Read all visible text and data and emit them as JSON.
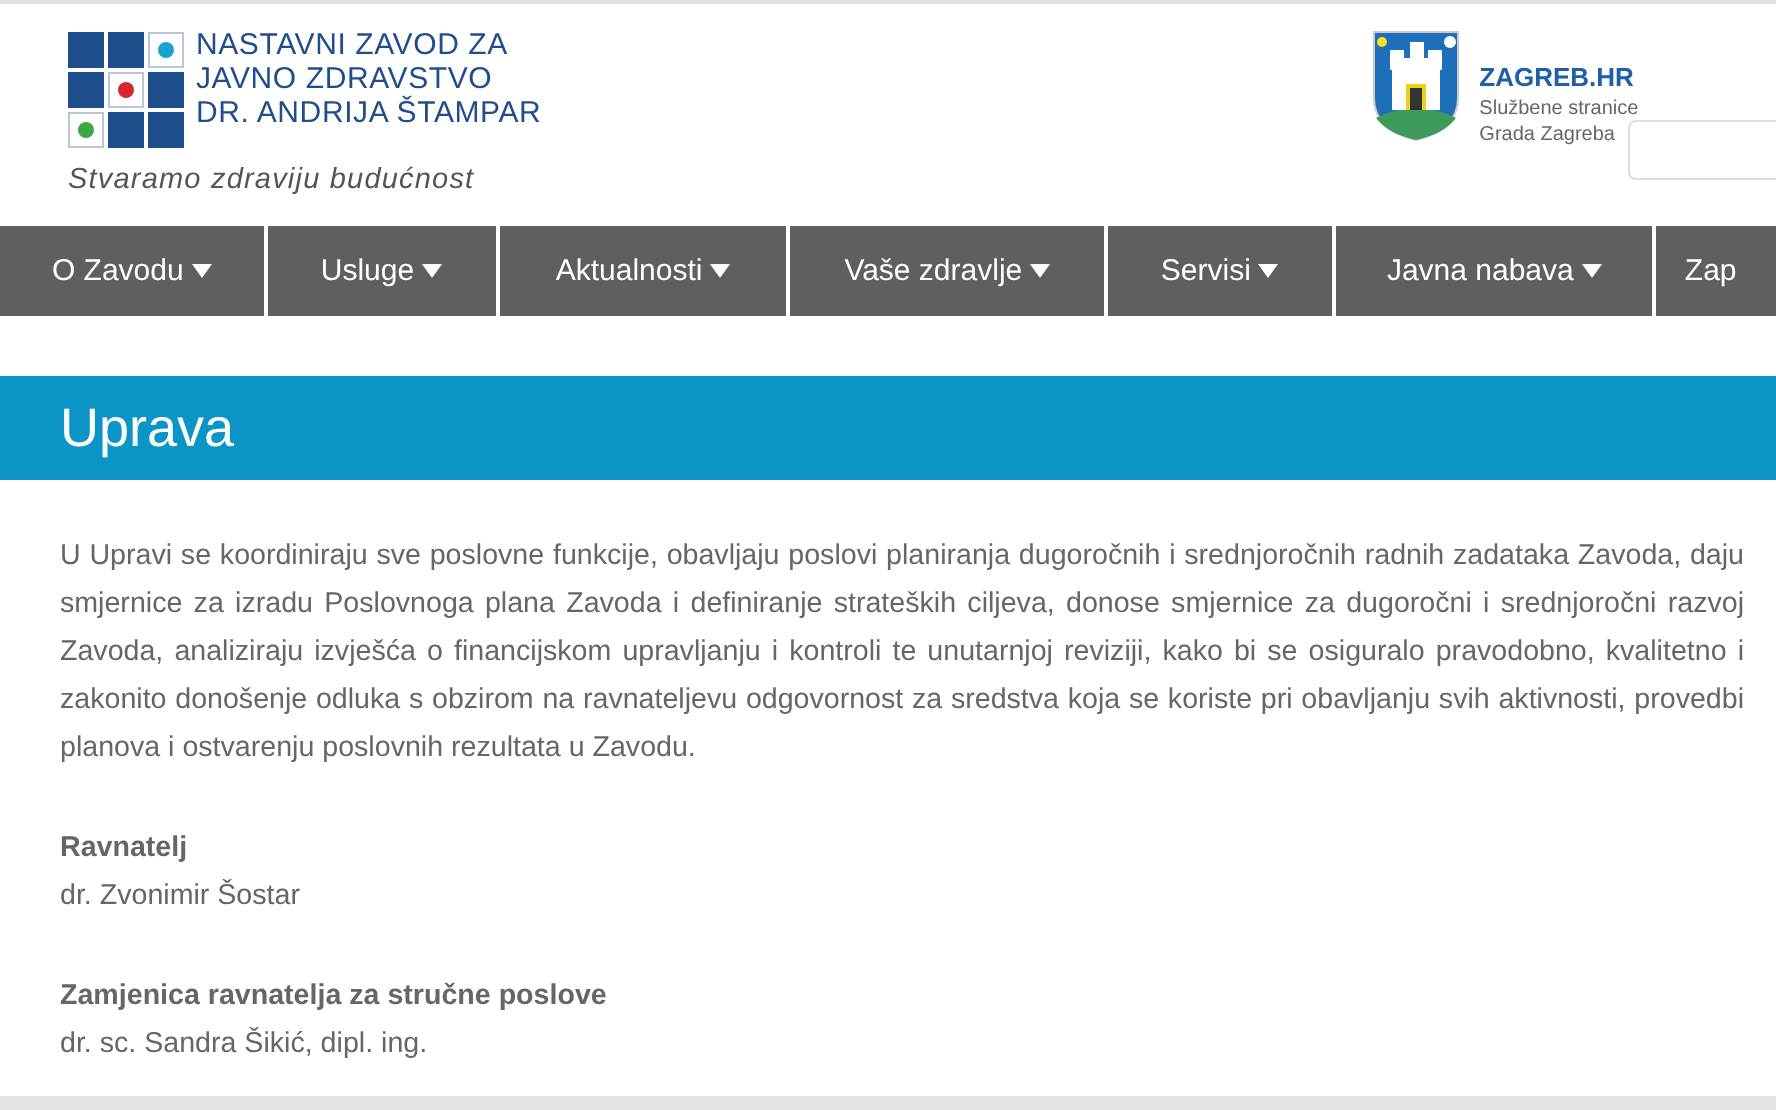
{
  "header": {
    "logo_lines": [
      "NASTAVNI ZAVOD ZA",
      "JAVNO ZDRAVSTVO",
      "DR. ANDRIJA ŠTAMPAR"
    ],
    "slogan": "Stvaramo zdraviju budućnost",
    "city_title": "ZAGREB.HR",
    "city_lines": [
      "Službene stranice",
      "Grada Zagreba"
    ]
  },
  "nav": [
    {
      "label": "O Zavodu",
      "dropdown": true
    },
    {
      "label": "Usluge",
      "dropdown": true
    },
    {
      "label": "Aktualnosti",
      "dropdown": true
    },
    {
      "label": "Vaše zdravlje",
      "dropdown": true
    },
    {
      "label": "Servisi",
      "dropdown": true
    },
    {
      "label": "Javna nabava",
      "dropdown": true
    },
    {
      "label": "Zap",
      "dropdown": false
    }
  ],
  "page_title": "Uprava",
  "intro": "U Upravi se koordiniraju sve poslovne funkcije, obavljaju poslovi planiranja dugoročnih i srednjoročnih radnih zadataka Zavoda, daju smjernice za izradu Poslovnoga plana Zavoda i definiranje strateških ciljeva, donose smjernice za dugoročni i srednjoročni razvoj Zavoda, analiziraju izvješća o financijskom upravljanju i kontroli te unutarnjoj reviziji, kako bi se osiguralo pravodobno, kvalitetno i zakonito donošenje odluka s obzirom na ravnateljevu odgovornost za sredstva koja se koriste pri obavljanju svih aktivnosti, provedbi planova i ostvarenju poslovnih rezultata u Zavodu.",
  "people": [
    {
      "role": "Ravnatelj",
      "name": "dr. Zvonimir Šostar"
    },
    {
      "role": "Zamjenica ravnatelja za stručne poslove",
      "name": "dr. sc. Sandra Šikić, dipl. ing."
    }
  ]
}
